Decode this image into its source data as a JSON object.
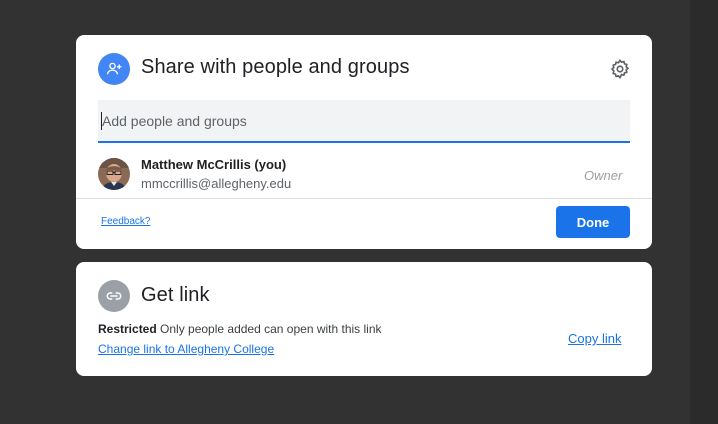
{
  "share": {
    "title": "Share with people and groups",
    "input_placeholder": "Add people and groups",
    "user": {
      "name": "Matthew McCrillis (you)",
      "email": "mmccrillis@allegheny.edu",
      "role": "Owner"
    },
    "feedback_label": "Feedback?",
    "done_label": "Done",
    "icons": {
      "header": "person-add-icon",
      "settings": "gear-icon"
    },
    "accent_color": "#1a73e8"
  },
  "link": {
    "title": "Get link",
    "restricted_label": "Restricted",
    "restricted_desc": "Only people added can open with this link",
    "change_label": "Change link to Allegheny College",
    "copy_label": "Copy link",
    "icons": {
      "header": "link-icon"
    }
  }
}
